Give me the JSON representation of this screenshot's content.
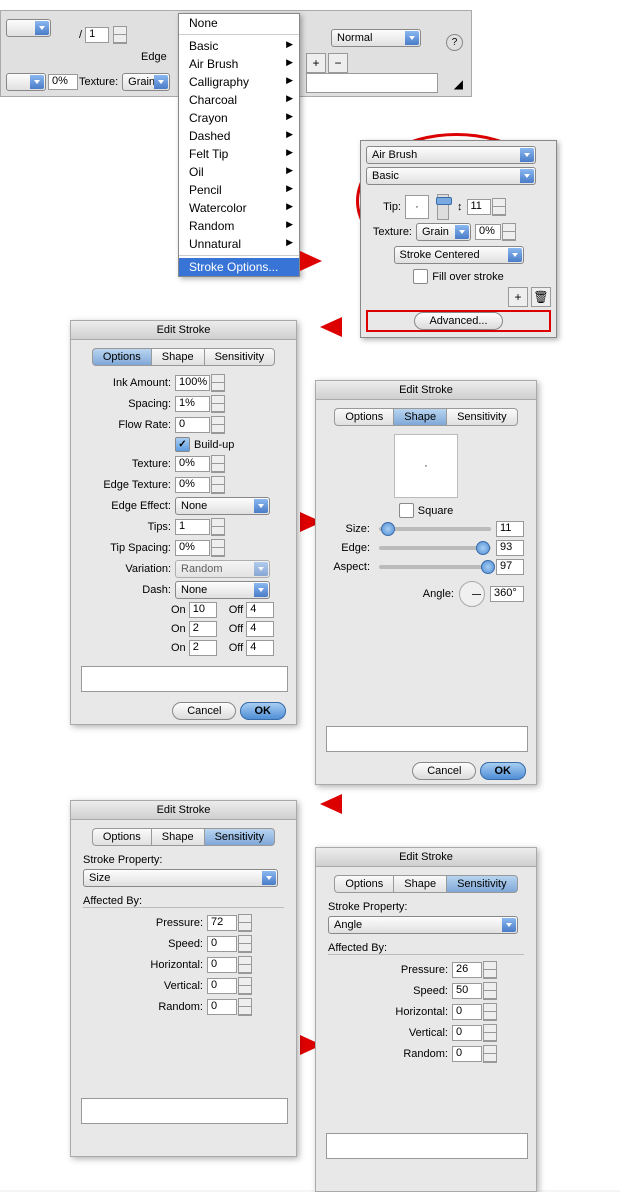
{
  "toolbar": {
    "stroke_val": "1",
    "edge_label": "Edge",
    "texture_label": "Texture:",
    "texture_val": "Grain",
    "normal": "Normal",
    "pct0": "0%",
    "eyedrop": "/"
  },
  "menu": {
    "none": "None",
    "basic": "Basic",
    "airbrush": "Air Brush",
    "calligraphy": "Calligraphy",
    "charcoal": "Charcoal",
    "crayon": "Crayon",
    "dashed": "Dashed",
    "felttip": "Felt Tip",
    "oil": "Oil",
    "pencil": "Pencil",
    "watercolor": "Watercolor",
    "random": "Random",
    "unnatural": "Unnatural",
    "strokeopts": "Stroke Options..."
  },
  "palette": {
    "cat": "Air Brush",
    "sub": "Basic",
    "tip": "Tip:",
    "tip_val": "11",
    "updown": "↕",
    "texture": "Texture:",
    "texture_val": "Grain",
    "texture_pct": "0%",
    "centered": "Stroke Centered",
    "fillover": "Fill over stroke",
    "advanced": "Advanced..."
  },
  "editstroke": "Edit Stroke",
  "tabs": {
    "options": "Options",
    "shape": "Shape",
    "sensitivity": "Sensitivity"
  },
  "options": {
    "ink": "Ink Amount:",
    "ink_v": "100%",
    "spacing": "Spacing:",
    "spacing_v": "1%",
    "flow": "Flow Rate:",
    "flow_v": "0",
    "buildup": "Build-up",
    "texture": "Texture:",
    "texture_v": "0%",
    "edgetex": "Edge Texture:",
    "edgetex_v": "0%",
    "edgeeff": "Edge Effect:",
    "edgeeff_v": "None",
    "tips": "Tips:",
    "tips_v": "1",
    "tipspacing": "Tip Spacing:",
    "tipspacing_v": "0%",
    "variation": "Variation:",
    "variation_v": "Random",
    "dash": "Dash:",
    "dash_v": "None",
    "on": "On",
    "off": "Off",
    "on1": "10",
    "off1": "4",
    "on2": "2",
    "off2": "4",
    "on3": "2",
    "off3": "4"
  },
  "shape": {
    "square": "Square",
    "size": "Size:",
    "size_v": "11",
    "edge": "Edge:",
    "edge_v": "93",
    "aspect": "Aspect:",
    "aspect_v": "97",
    "angle": "Angle:",
    "angle_v": "360°"
  },
  "sens": {
    "property": "Stroke Property:",
    "affected": "Affected By:",
    "pressure": "Pressure:",
    "speed": "Speed:",
    "horizontal": "Horizontal:",
    "vertical": "Vertical:",
    "random": "Random:"
  },
  "sens1": {
    "prop": "Size",
    "pressure": "72",
    "speed": "0",
    "horizontal": "0",
    "vertical": "0",
    "random": "0"
  },
  "sens2": {
    "prop": "Angle",
    "pressure": "26",
    "speed": "50",
    "horizontal": "0",
    "vertical": "0",
    "random": "0"
  },
  "btns": {
    "cancel": "Cancel",
    "ok": "OK"
  }
}
